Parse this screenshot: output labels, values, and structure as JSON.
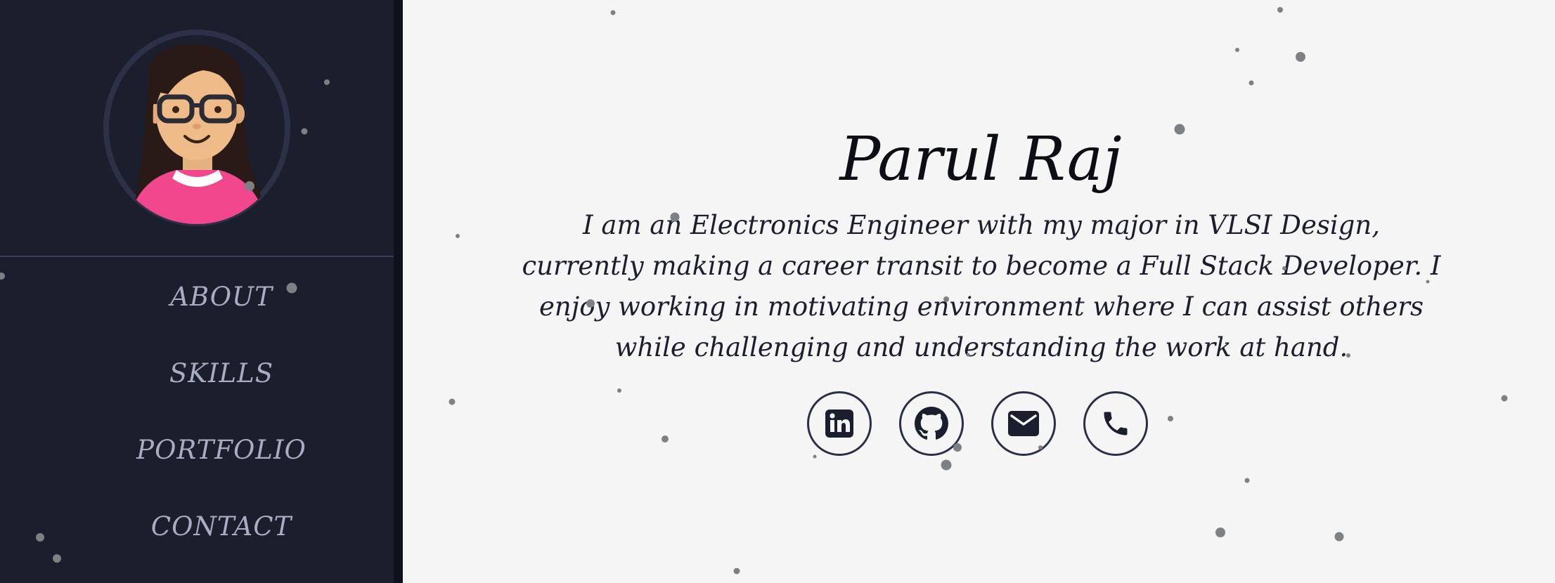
{
  "sidebar": {
    "avatar_alt": "Cartoon portrait avatar",
    "nav": [
      {
        "label": "ABOUT"
      },
      {
        "label": "SKILLS"
      },
      {
        "label": "PORTFOLIO"
      },
      {
        "label": "CONTACT"
      }
    ]
  },
  "hero": {
    "name": "Parul Raj",
    "bio": "I am an Electronics Engineer with my major in VLSI Design, currently making a career transit to become a Full Stack Developer. I enjoy working in motivating environment where I can assist others while challenging and understanding the work at hand."
  },
  "social": [
    {
      "icon": "linkedin-icon"
    },
    {
      "icon": "github-icon"
    },
    {
      "icon": "mail-icon"
    },
    {
      "icon": "phone-icon"
    }
  ],
  "colors": {
    "sidebar_bg": "#1b1e2c",
    "page_bg": "#f5f5f5",
    "nav_text": "#a8adc4",
    "accent_dark": "#2b2f45",
    "particle": "#7d8184"
  }
}
